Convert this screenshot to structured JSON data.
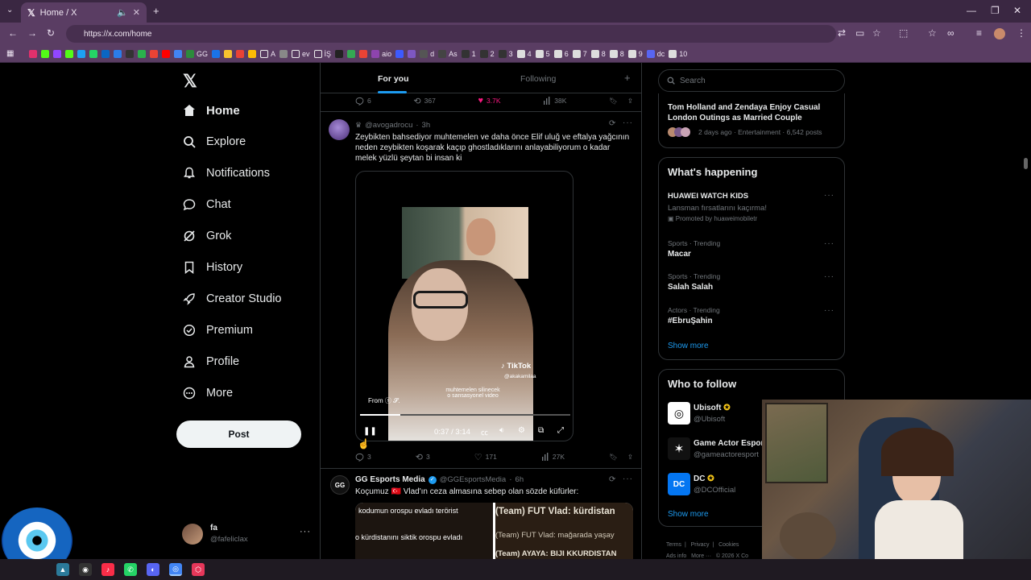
{
  "browser": {
    "tab_title": "Home / X",
    "new_tab_icon": "+",
    "url": "https://x.com/home",
    "bookmarks": [
      "GG",
      "A",
      "ev",
      "İŞ",
      "aio",
      "d",
      "As",
      "1",
      "2",
      "3",
      "4",
      "5",
      "6",
      "7",
      "8",
      "8",
      "9",
      "dc",
      "10"
    ]
  },
  "nav": {
    "logo": "𝕏",
    "items": [
      {
        "label": "Home",
        "icon": "home-icon"
      },
      {
        "label": "Explore",
        "icon": "search-icon"
      },
      {
        "label": "Notifications",
        "icon": "bell-icon"
      },
      {
        "label": "Chat",
        "icon": "chat-icon"
      },
      {
        "label": "Grok",
        "icon": "grok-icon"
      },
      {
        "label": "History",
        "icon": "bookmark-icon"
      },
      {
        "label": "Creator Studio",
        "icon": "rocket-icon"
      },
      {
        "label": "Premium",
        "icon": "verified-icon"
      },
      {
        "label": "Profile",
        "icon": "person-icon"
      },
      {
        "label": "More",
        "icon": "more-circle-icon"
      }
    ],
    "post_label": "Post",
    "profile": {
      "name": "fa",
      "handle": "@fafeliclax"
    }
  },
  "feed": {
    "tabs": {
      "for_you": "For you",
      "following": "Following"
    },
    "prev_actions": {
      "replies": "6",
      "reposts": "367",
      "likes": "3.7K",
      "views": "38K"
    },
    "tweet1": {
      "handle": "@avogadrocu",
      "time": "3h",
      "text": "Zeybikten bahsediyor muhtemelen ve daha önce Elif uluğ ve eftalya yağcının neden zeybikten koşarak kaçıp ghostladıklarını anlayabiliyorum o kadar melek yüzlü şeytan bi insan ki",
      "video": {
        "time": "0:37 / 3:14",
        "progress": 0.19,
        "tiktok_label": "TikTok",
        "tiktok_handle": "@akakamilaa",
        "caption1": "muhtemelen silinecek",
        "caption2": "o sansasyonel video",
        "from_label": "From"
      },
      "actions": {
        "replies": "3",
        "reposts": "3",
        "likes": "171",
        "views": "27K"
      }
    },
    "tweet2": {
      "name": "GG Esports Media",
      "handle": "@GGEsportsMedia",
      "time": "6h",
      "text": "Koçumuz 🇹🇷 Vlad'ın ceza almasına sebep olan sözde küfürler:",
      "img_lines_left": [
        "kodumun orospu evladı terörist",
        "o kürdistanını siktik orospu evladı"
      ],
      "img_lines_right": [
        "(Team) FUT Vlad: kürdistan",
        "(Team) FUT Vlad: mağarada yaşay",
        "(Team) AYAYA: BIJI KKURDISTAN"
      ]
    }
  },
  "right": {
    "search_placeholder": "Search",
    "news": {
      "title": "Tom Holland and Zendaya Enjoy Casual London Outings as Married Couple",
      "meta": "2 days ago · Entertainment · 6,542 posts"
    },
    "happening": {
      "title": "What's happening",
      "items": [
        {
          "meta": "",
          "title": "HUAWEI WATCH KIDS",
          "sub": "Lansman fırsatlarını kaçırma!",
          "promo": "Promoted by huaweimobiletr"
        },
        {
          "meta": "Sports · Trending",
          "title": "Macar"
        },
        {
          "meta": "Sports · Trending",
          "title": "Salah Salah"
        },
        {
          "meta": "Actors · Trending",
          "title": "#EbruŞahin"
        }
      ],
      "show_more": "Show more"
    },
    "follow": {
      "title": "Who to follow",
      "items": [
        {
          "name": "Ubisoft",
          "handle": "@Ubisoft"
        },
        {
          "name": "Game Actor Espor",
          "handle": "@gameactoresport"
        },
        {
          "name": "DC",
          "handle": "@DCOfficial"
        }
      ],
      "show_more": "Show more"
    },
    "footer": {
      "terms": "Terms",
      "privacy": "Privacy",
      "cookies": "Cookies",
      "ads": "Ads info",
      "more": "More ···",
      "copyright": "© 2026 X Co"
    }
  },
  "colors": {
    "accent": "#1d9bf0",
    "like": "#f91880",
    "browser_bg": "#5a3d63"
  }
}
